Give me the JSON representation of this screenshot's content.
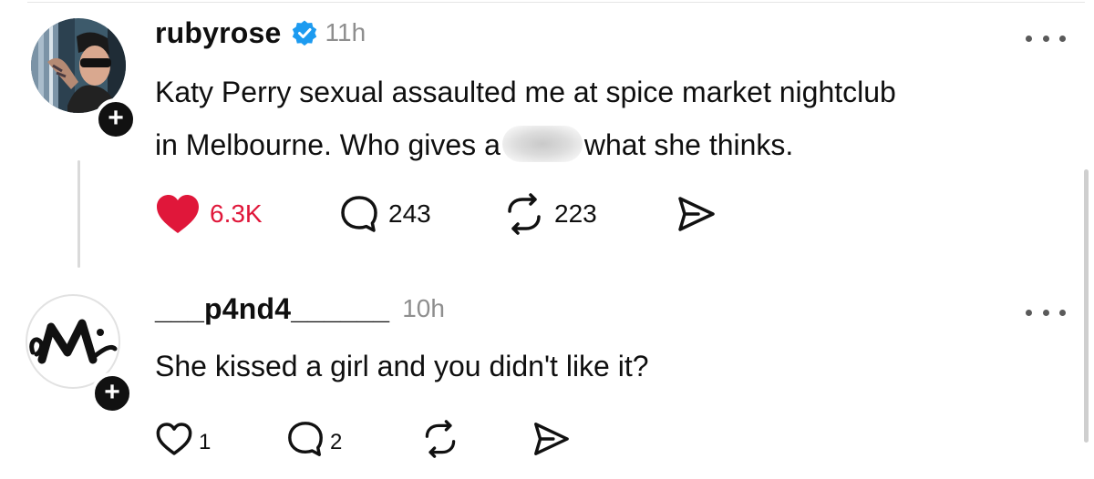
{
  "posts": [
    {
      "username": "rubyrose",
      "verified": true,
      "time": "11h",
      "text_line1": "Katy Perry sexual assaulted me at spice market nightclub",
      "text_line2_before": "in Melbourne. Who gives a",
      "text_line2_after": "what she thinks.",
      "likes": "6.3K",
      "liked": true,
      "replies": "243",
      "reposts": "223",
      "follow_badge": "+"
    },
    {
      "username": "___p4nd4______",
      "time": "10h",
      "text": "She kissed a girl and you didn't like it?",
      "likes": "1",
      "replies": "2",
      "follow_badge": "+"
    }
  ],
  "colors": {
    "like_red": "#e0173a",
    "verified_blue": "#1d9bf0",
    "muted_gray": "#8e8e8e"
  },
  "icons": [
    "verified-badge-icon",
    "more-options-icon",
    "heart-icon",
    "comment-icon",
    "repost-icon",
    "share-icon",
    "plus-icon"
  ]
}
